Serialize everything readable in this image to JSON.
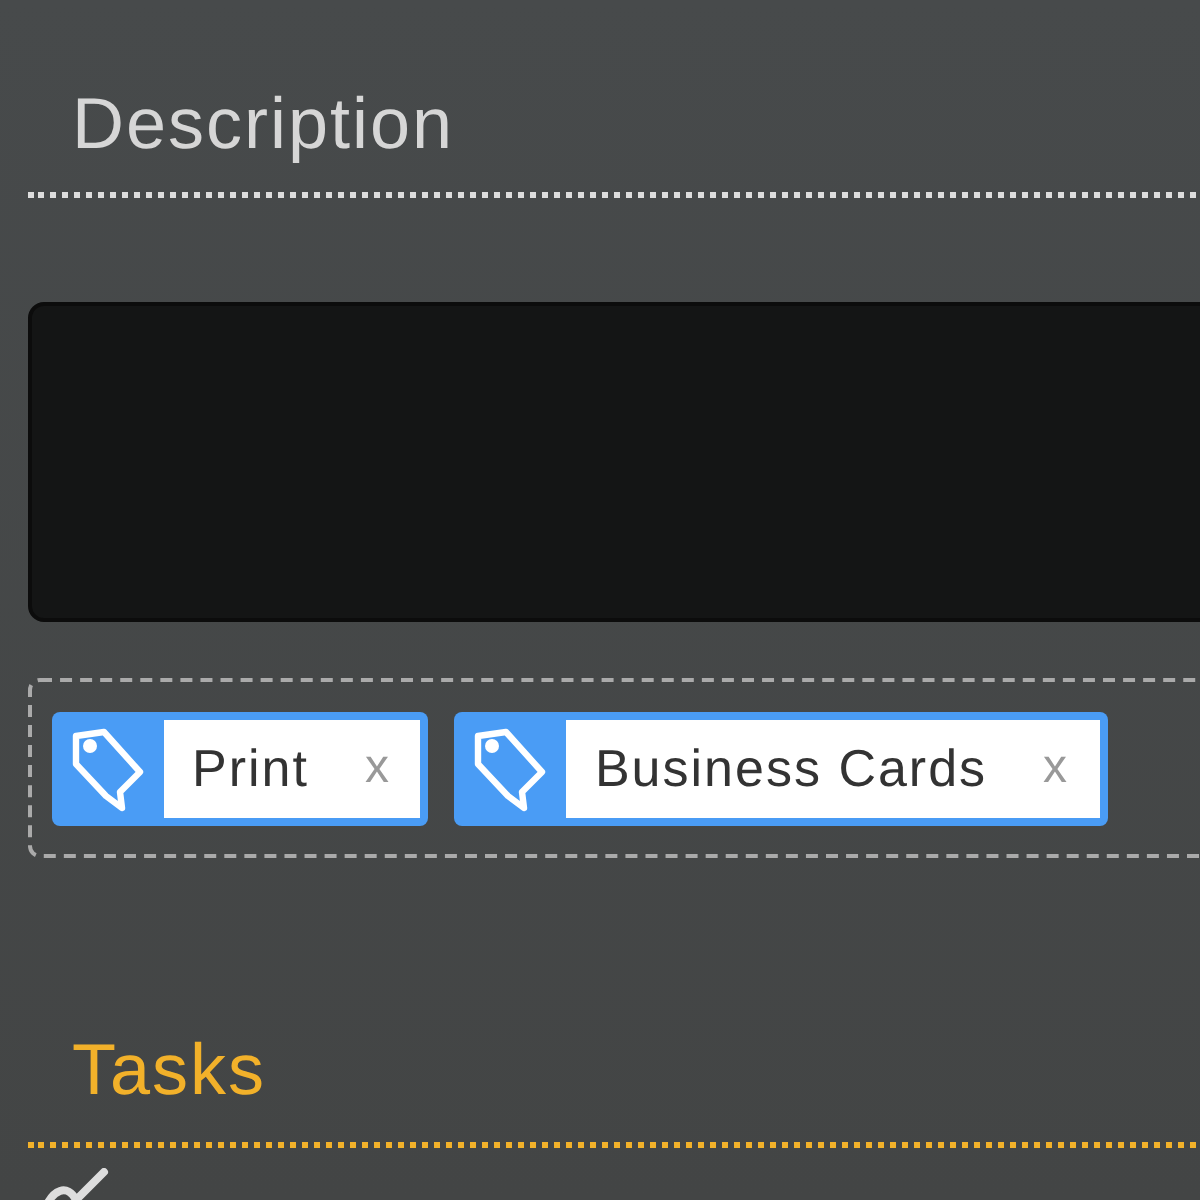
{
  "description": {
    "heading": "Description"
  },
  "tags": [
    {
      "label": "Print",
      "remove": "x"
    },
    {
      "label": "Business Cards",
      "remove": "x"
    }
  ],
  "tasks": {
    "heading": "Tasks"
  }
}
